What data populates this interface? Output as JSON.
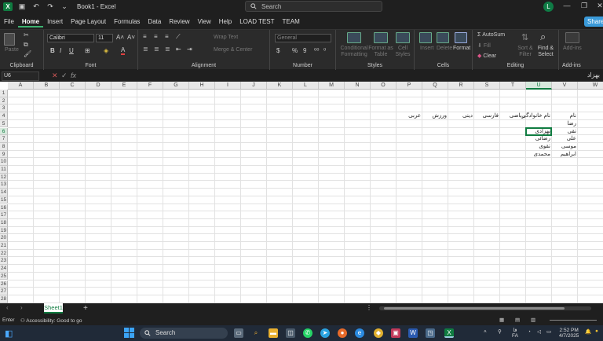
{
  "titlebar": {
    "file_name": "Book1 - Excel",
    "search_placeholder": "Search",
    "user_initial": "L",
    "minimize": "—",
    "restore": "❐",
    "close": "✕"
  },
  "menu": {
    "tabs": [
      "File",
      "Home",
      "Insert",
      "Page Layout",
      "Formulas",
      "Data",
      "Review",
      "View",
      "Help",
      "LOAD TEST",
      "TEAM"
    ],
    "share": "Share"
  },
  "ribbon": {
    "clipboard": {
      "paste": "Paste",
      "label": "Clipboard"
    },
    "font": {
      "name": "Calibri",
      "size": "11",
      "label": "Font"
    },
    "alignment": {
      "wrap_text": "Wrap Text",
      "merge_center": "Merge & Center",
      "label": "Alignment"
    },
    "number": {
      "format": "General",
      "label": "Number"
    },
    "styles": {
      "conditional": "Conditional Formatting",
      "format_table": "Format as Table",
      "cell_styles": "Cell Styles",
      "label": "Styles"
    },
    "cells": {
      "insert": "Insert",
      "delete": "Delete",
      "format": "Format",
      "label": "Cells"
    },
    "editing": {
      "autosum": "AutoSum",
      "fill": "Fill",
      "clear": "Clear",
      "sort_filter": "Sort & Filter",
      "find_select": "Find & Select",
      "label": "Editing"
    },
    "addins": {
      "addins": "Add-ins",
      "label": "Add-ins"
    }
  },
  "formula_bar": {
    "name_box": "U6",
    "value": "بهزاد"
  },
  "columns": [
    "A",
    "B",
    "C",
    "D",
    "E",
    "F",
    "G",
    "H",
    "I",
    "J",
    "K",
    "L",
    "M",
    "N",
    "O",
    "P",
    "Q",
    "R",
    "S",
    "T",
    "U",
    "V",
    "W"
  ],
  "rows": [
    "1",
    "2",
    "3",
    "4",
    "5",
    "6",
    "7",
    "8",
    "9",
    "10",
    "11",
    "12",
    "13",
    "14",
    "15",
    "16",
    "17",
    "18",
    "19",
    "20",
    "21",
    "22",
    "23",
    "24",
    "25",
    "26",
    "27",
    "28"
  ],
  "cells": {
    "V4": "نام",
    "U4": "نام خانوادگی",
    "T4": "ریاضی",
    "S4": "فارسی",
    "R4": "دینی",
    "Q4": "ورزش",
    "P4": "عربی",
    "V5": "رضا",
    "V6": "تقی",
    "U6": "بهزادی",
    "V7": "علی",
    "U7": "رضائی",
    "V8": "موسی",
    "U8": "تقوی",
    "V9": "ابراهیم",
    "U9": "محمدی"
  },
  "sheets": {
    "active": "Sheet1",
    "add": "+"
  },
  "status": {
    "mode": "Enter",
    "accessibility": "Accessibility: Good to go"
  },
  "taskbar": {
    "search": "Search",
    "lang1": "فا",
    "lang2": "FA",
    "time": "2:52 PM",
    "date": "4/7/2025"
  }
}
